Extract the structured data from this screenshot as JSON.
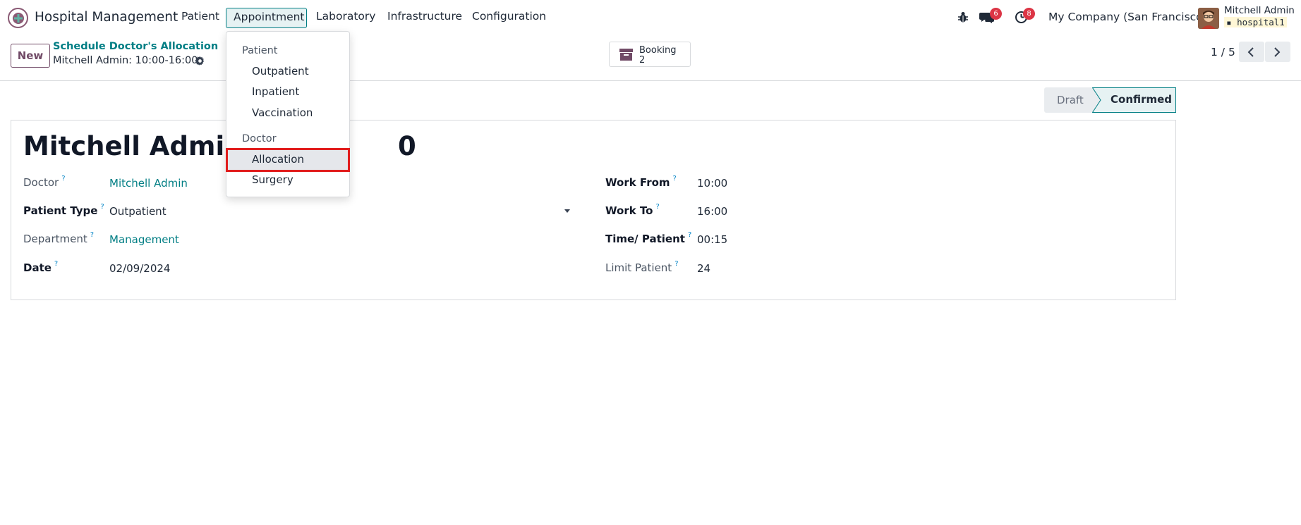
{
  "navbar": {
    "app_title": "Hospital Management",
    "menu": [
      "Patient",
      "Appointment",
      "Laboratory",
      "Infrastructure",
      "Configuration"
    ],
    "messages_badge": "6",
    "activities_badge": "8",
    "company": "My Company (San Francisco)",
    "user_name": "Mitchell Admin",
    "db_name": "hospital1"
  },
  "control_panel": {
    "new_label": "New",
    "breadcrumb": "Schedule Doctor's Allocation",
    "record_name": "Mitchell Admin: 10:00-16:00",
    "booking_label": "Booking",
    "booking_count": "2",
    "pager": "1 / 5"
  },
  "status_bar": {
    "draft": "Draft",
    "confirmed": "Confirmed",
    "active": "Confirmed"
  },
  "form": {
    "title_left": "Mitchell Admin: 1",
    "title_right": "0",
    "doctor_label": "Doctor",
    "doctor_value": "Mitchell Admin",
    "patient_type_label": "Patient Type",
    "patient_type_value": "Outpatient",
    "department_label": "Department",
    "department_value": "Management",
    "date_label": "Date",
    "date_value": "02/09/2024",
    "work_from_label": "Work From",
    "work_from_value": "10:00",
    "work_to_label": "Work To",
    "work_to_value": "16:00",
    "time_patient_label": "Time/ Patient",
    "time_patient_value": "00:15",
    "limit_patient_label": "Limit Patient",
    "limit_patient_value": "24",
    "help_mark": "?"
  },
  "dropdown": {
    "section_patient": "Patient",
    "items_patient": [
      "Outpatient",
      "Inpatient",
      "Vaccination"
    ],
    "section_doctor": "Doctor",
    "items_doctor": [
      "Allocation",
      "Surgery"
    ],
    "highlighted": "Allocation"
  },
  "colors": {
    "brand": "#714b67",
    "link": "#017e84",
    "highlight_border": "#e11d1d",
    "badge": "#dc3545"
  }
}
